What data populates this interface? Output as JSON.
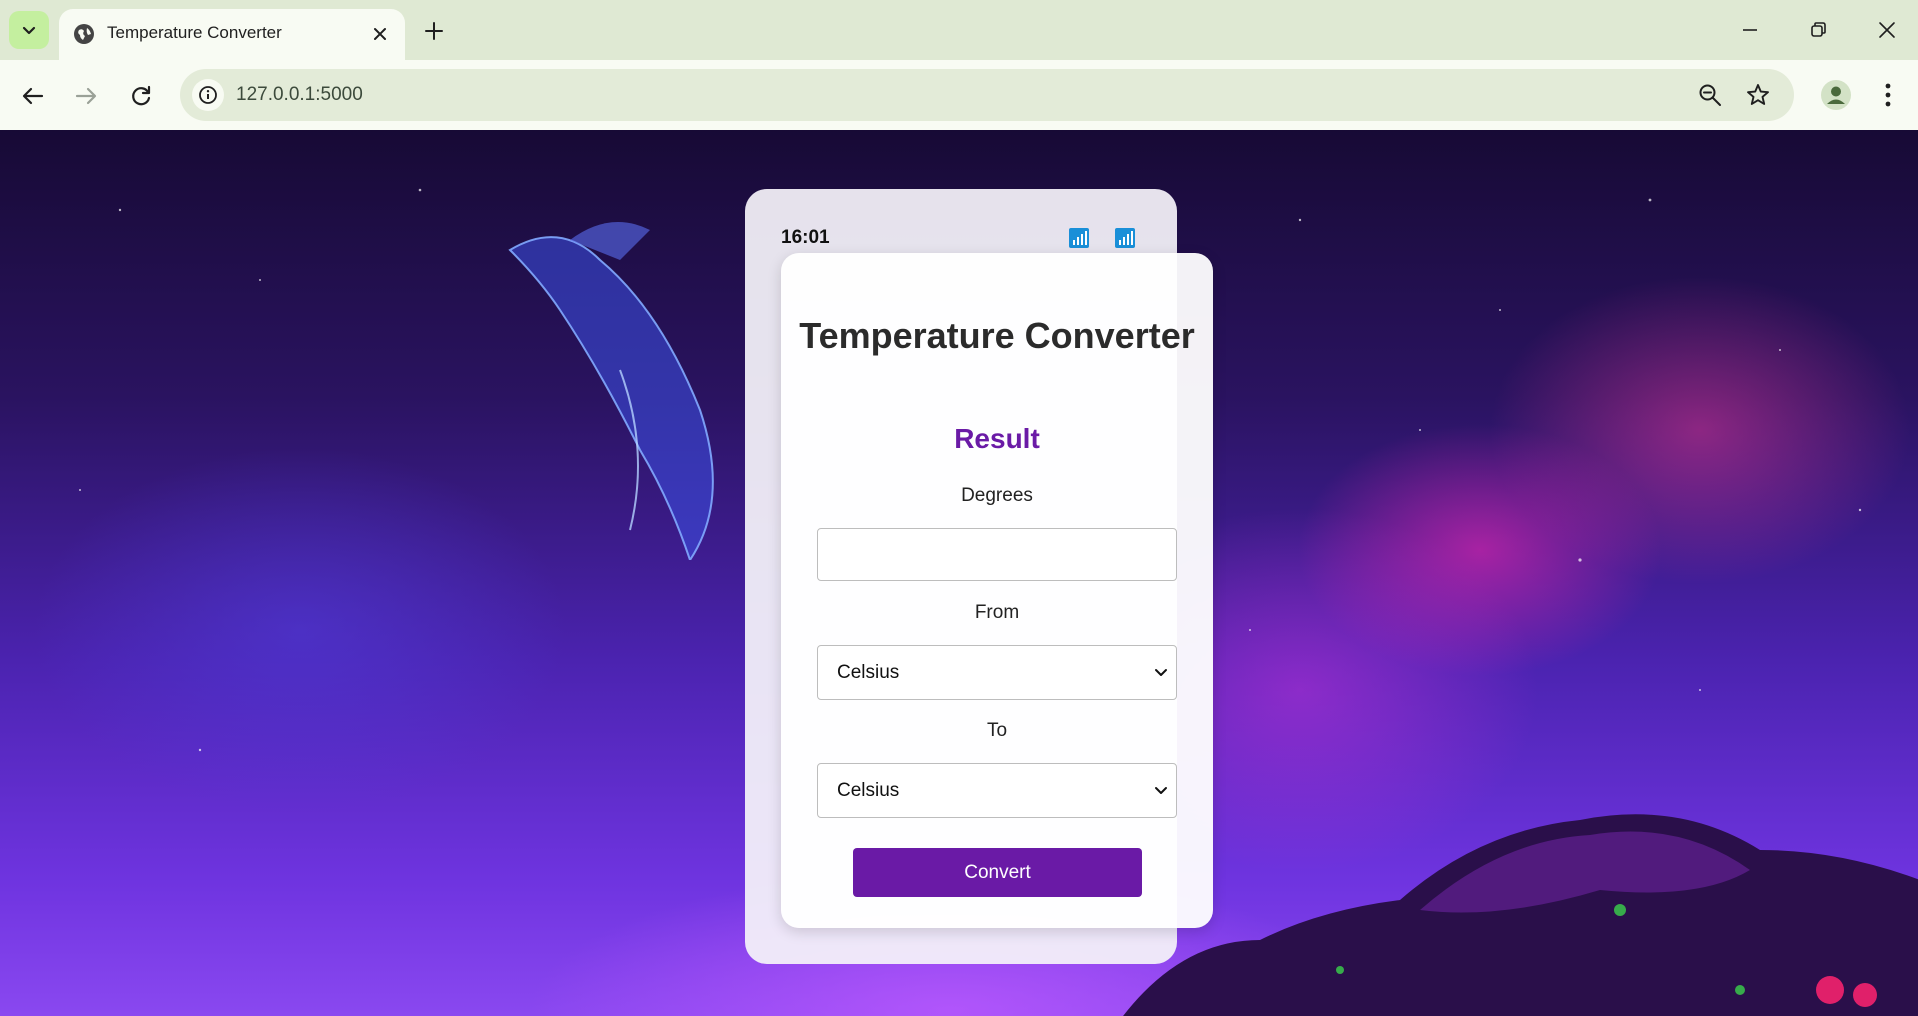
{
  "browser": {
    "tab_title": "Temperature Converter",
    "url": "127.0.0.1:5000",
    "icons": {
      "tab_search": "chevron-down-icon",
      "favicon": "globe-icon",
      "tab_close": "close-icon",
      "new_tab": "plus-icon",
      "minimize": "minimize-icon",
      "maximize": "restore-icon",
      "close_window": "close-icon",
      "back": "arrow-left-icon",
      "forward": "arrow-right-icon",
      "reload": "reload-icon",
      "site_info": "info-icon",
      "zoom": "zoom-icon",
      "bookmark": "star-icon",
      "profile": "person-icon",
      "menu": "kebab-menu-icon"
    }
  },
  "phone": {
    "time": "16:01",
    "icons": [
      "signal-icon",
      "signal-icon"
    ]
  },
  "converter": {
    "title": "Temperature Converter",
    "result_label": "Result",
    "degrees_label": "Degrees",
    "degrees_value": "",
    "from_label": "From",
    "from_value": "Celsius",
    "to_label": "To",
    "to_value": "Celsius",
    "convert_label": "Convert"
  },
  "colors": {
    "accent": "#6a1aa6",
    "chrome_bg": "#dfe9d3",
    "toolbar_bg": "#f8fbf3"
  }
}
